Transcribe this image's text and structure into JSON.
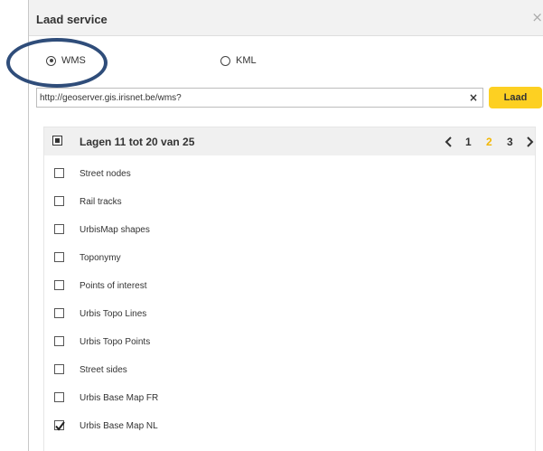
{
  "dialog": {
    "title": "Laad service",
    "close_glyph": "×"
  },
  "source_type": {
    "options": [
      {
        "label": "WMS",
        "checked": true
      },
      {
        "label": "KML",
        "checked": false
      }
    ]
  },
  "url": {
    "value": "http://geoserver.gis.irisnet.be/wms?",
    "clear_glyph": "×"
  },
  "load_button": {
    "label": "Laad",
    "color": "#fdd022"
  },
  "layers": {
    "header_title": "Lagen 11 tot 20 van 25",
    "pages": [
      "1",
      "2",
      "3"
    ],
    "current_page": "2",
    "accent_color": "#f2b705",
    "items": [
      {
        "label": "Street nodes",
        "checked": false
      },
      {
        "label": "Rail tracks",
        "checked": false
      },
      {
        "label": "UrbisMap shapes",
        "checked": false
      },
      {
        "label": "Toponymy",
        "checked": false
      },
      {
        "label": "Points of interest",
        "checked": false
      },
      {
        "label": "Urbis Topo Lines",
        "checked": false
      },
      {
        "label": "Urbis Topo Points",
        "checked": false
      },
      {
        "label": "Street sides",
        "checked": false
      },
      {
        "label": "Urbis Base Map FR",
        "checked": false
      },
      {
        "label": "Urbis Base Map NL",
        "checked": true
      }
    ]
  }
}
